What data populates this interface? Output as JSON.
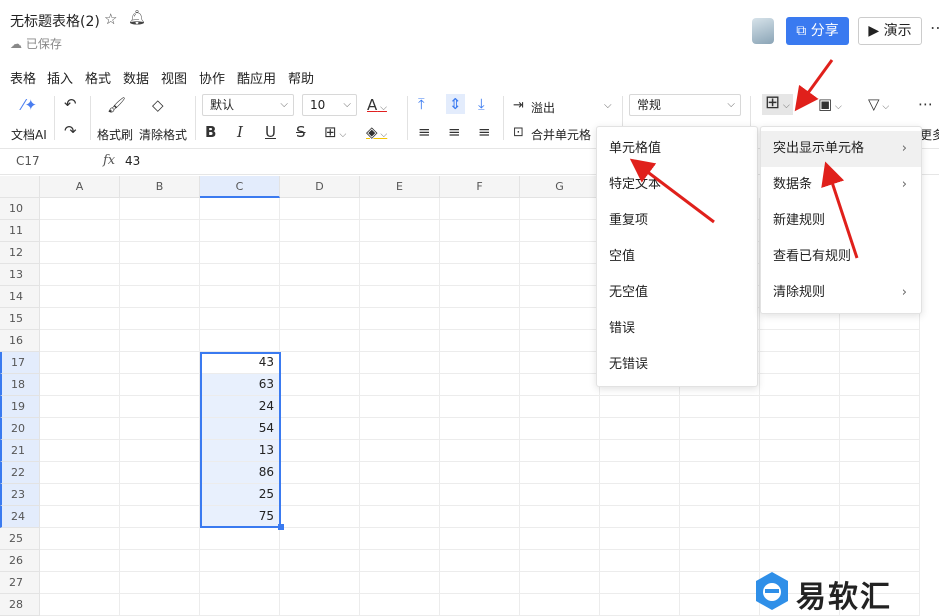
{
  "doc": {
    "title": "无标题表格(2)",
    "saved": "已保存"
  },
  "header": {
    "share": "分享",
    "present": "演示"
  },
  "menu": [
    "表格",
    "插入",
    "格式",
    "数据",
    "视图",
    "协作",
    "酷应用",
    "帮助"
  ],
  "toolbar": {
    "doc_ai": "文档AI",
    "format_painter": "格式刷",
    "clear_format": "清除格式",
    "font": "默认",
    "size": "10",
    "overflow": "溢出",
    "merge": "合并单元格",
    "number_format": "常规",
    "more": "更多"
  },
  "formula": {
    "cell_ref": "C17",
    "fx": "fx",
    "value": "43"
  },
  "columns": [
    "A",
    "B",
    "C",
    "D",
    "E",
    "F",
    "G"
  ],
  "rows": [
    "10",
    "11",
    "12",
    "13",
    "14",
    "15",
    "16",
    "17",
    "18",
    "19",
    "20",
    "21",
    "22",
    "23",
    "24",
    "25",
    "26",
    "27",
    "28"
  ],
  "values": [
    "43",
    "63",
    "24",
    "54",
    "13",
    "86",
    "25",
    "75"
  ],
  "submenu": [
    "单元格值",
    "特定文本",
    "重复项",
    "空值",
    "无空值",
    "错误",
    "无错误"
  ],
  "cond_menu": [
    {
      "label": "突出显示单元格",
      "has_sub": true
    },
    {
      "label": "数据条",
      "has_sub": true
    },
    {
      "label": "新建规则",
      "has_sub": false
    },
    {
      "label": "查看已有规则",
      "has_sub": false
    },
    {
      "label": "清除规则",
      "has_sub": true
    }
  ],
  "logo_text": "易软汇",
  "colors": {
    "accent": "#3a7af0",
    "arrow": "#e0201b",
    "selection": "#e8f0fd"
  }
}
